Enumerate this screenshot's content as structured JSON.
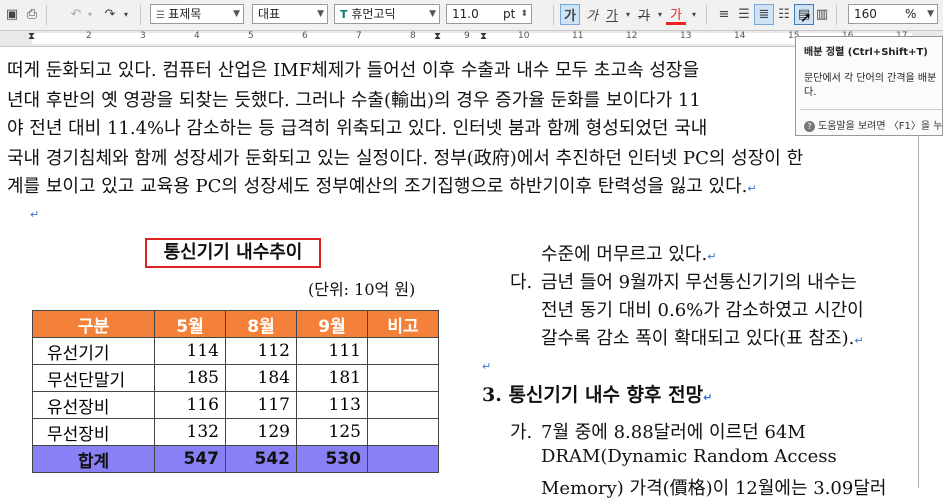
{
  "toolbar": {
    "style_value": "표제목",
    "font_lang_value": "대표",
    "font_name_value": "휴먼고딕",
    "font_size_value": "11.0",
    "font_size_unit": "pt",
    "zoom_value": "160",
    "zoom_unit": "%",
    "bold_label": "가",
    "italic_label": "가",
    "underline_label": "가",
    "strike_label": "가",
    "color_label": "가"
  },
  "ruler": {
    "numbers": [
      "2",
      "3",
      "4",
      "5",
      "6",
      "7",
      "8",
      "9",
      "10",
      "11",
      "12",
      "13",
      "14",
      "15",
      "16",
      "17"
    ]
  },
  "body": {
    "lines": [
      "떠게 둔화되고 있다. 컴퓨터 산업은 IMF체제가 들어선 이후 수출과 내수 모두 초고속 성장을",
      "년대 후반의 옛 영광을 되찾는 듯했다. 그러나 수출(輸出)의 경우 증가율 둔화를 보이다가 11",
      "야 전년 대비 11.4%나 감소하는 등 급격히 위축되고 있다. 인터넷 붐과 함께 형성되었던 국내",
      "국내 경기침체와 함께 성장세가 둔화되고 있는 실정이다. 정부(政府)에서 추진하던 인터넷 PC의 성장이 한",
      "계를 보이고 있고 교육용 PC의 성장세도 정부예산의 조기집행으로 하반기이후 탄력성을 잃고 있다."
    ]
  },
  "table": {
    "title": "통신기기 내수추이",
    "unit": "(단위: 10억 원)",
    "headers": [
      "구분",
      "5월",
      "8월",
      "9월",
      "비고"
    ],
    "rows": [
      [
        "유선기기",
        "114",
        "112",
        "111"
      ],
      [
        "무선단말기",
        "185",
        "184",
        "181"
      ],
      [
        "유선장비",
        "116",
        "117",
        "113"
      ],
      [
        "무선장비",
        "132",
        "129",
        "125"
      ]
    ],
    "total": [
      "합계",
      "547",
      "542",
      "530"
    ]
  },
  "right": {
    "line1": "수준에 머무르고 있다.",
    "item_da_label": "다.",
    "item_da_lines": [
      "금년 들어 9월까지 무선통신기기의 내수는",
      "전년 동기 대비 0.6%가 감소하였고 시간이",
      "갈수록 감소 폭이 확대되고 있다(표 참조)."
    ],
    "heading": "3. 통신기기 내수 향후 전망",
    "item_ga_label": "가.",
    "item_ga_lines": [
      "7월  중에  8.88달러에  이르던  64M",
      "DRAM(Dynamic     Random     Access",
      "Memory) 가격(價格)이 12월에는 3.09달러"
    ]
  },
  "tooltip": {
    "title": "배분 정렬 (Ctrl+Shift+T)",
    "desc_line1": "문단에서 각 단어의 간격을 배분",
    "desc_line2": "다.",
    "help": "도움말을 보려면 〈F1〉을 누"
  }
}
